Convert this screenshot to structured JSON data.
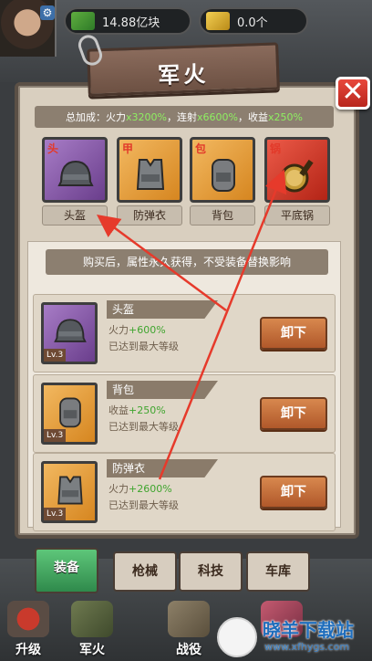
{
  "resources": {
    "money": "14.88亿块",
    "gold": "0.0个"
  },
  "dialog": {
    "title": "军火",
    "close_symbol": "✕"
  },
  "bonus": {
    "prefix": "总加成：",
    "firepower_label": "火力",
    "firepower_value": "x3200%",
    "sep1": "，",
    "rapid_label": "连射",
    "rapid_value": "x6600%",
    "sep2": "，",
    "income_label": "收益",
    "income_value": "x250%"
  },
  "slots": [
    {
      "tag": "头",
      "name": "头盔",
      "icon": "helmet-icon"
    },
    {
      "tag": "甲",
      "name": "防弹衣",
      "icon": "vest-icon"
    },
    {
      "tag": "包",
      "name": "背包",
      "icon": "backpack-icon"
    },
    {
      "tag": "锅",
      "name": "平底锅",
      "icon": "pan-icon"
    }
  ],
  "notice": "购买后，属性永久获得，不受装备替换影响",
  "items": [
    {
      "title": "头盔",
      "stat_label": "火力",
      "stat_value": "+600%",
      "status": "已达到最大等级",
      "level": "Lv.3",
      "button": "卸下",
      "icon": "helmet-icon"
    },
    {
      "title": "背包",
      "stat_label": "收益",
      "stat_value": "+250%",
      "status": "已达到最大等级",
      "level": "Lv.3",
      "button": "卸下",
      "icon": "backpack-icon"
    },
    {
      "title": "防弹衣",
      "stat_label": "火力",
      "stat_value": "+2600%",
      "status": "已达到最大等级",
      "level": "Lv.3",
      "button": "卸下",
      "icon": "vest-icon"
    }
  ],
  "tabs": [
    "装备",
    "枪械",
    "科技",
    "车库"
  ],
  "bottom_nav": [
    "升级",
    "军火",
    "战役"
  ],
  "watermark": {
    "title": "晓羊下载站",
    "url": "www.xfhygs.com"
  },
  "colors": {
    "highlight_green": "#8ef061",
    "stat_green": "#3fa52e",
    "arrow_red": "#e63a2b",
    "tab_active": "#3fa55f"
  }
}
